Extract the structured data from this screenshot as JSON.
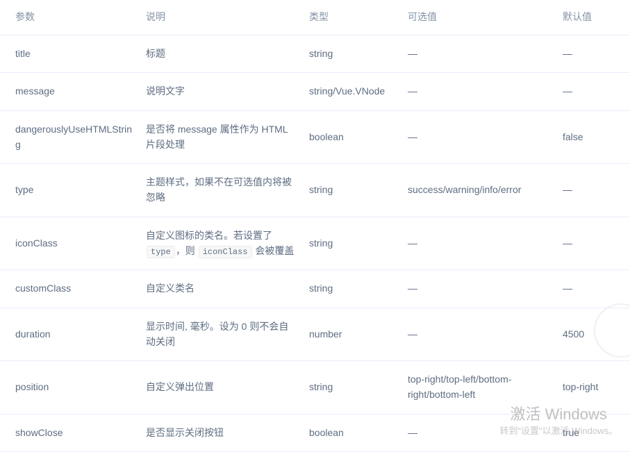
{
  "table": {
    "columns": [
      {
        "key": "param",
        "label": "参数"
      },
      {
        "key": "desc",
        "label": "说明"
      },
      {
        "key": "type",
        "label": "类型"
      },
      {
        "key": "options",
        "label": "可选值"
      },
      {
        "key": "default",
        "label": "默认值"
      }
    ],
    "rows": [
      {
        "param": "title",
        "desc": "标题",
        "type": "string",
        "options": "—",
        "default": "—"
      },
      {
        "param": "message",
        "desc": "说明文字",
        "type": "string/Vue.VNode",
        "options": "—",
        "default": "—"
      },
      {
        "param": "dangerouslyUseHTMLString",
        "desc": "是否将 message 属性作为 HTML 片段处理",
        "type": "boolean",
        "options": "—",
        "default": "false"
      },
      {
        "param": "type",
        "desc": "主题样式，如果不在可选值内将被忽略",
        "type": "string",
        "options": "success/warning/info/error",
        "default": "—"
      },
      {
        "param": "iconClass",
        "desc_parts": [
          {
            "kind": "text",
            "value": "自定义图标的类名。若设置了 "
          },
          {
            "kind": "code",
            "value": "type"
          },
          {
            "kind": "text",
            "value": "，则 "
          },
          {
            "kind": "code",
            "value": "iconClass"
          },
          {
            "kind": "text",
            "value": " 会被覆盖"
          }
        ],
        "desc": "自定义图标的类名。若设置了 type ，则 iconClass 会被覆盖",
        "type": "string",
        "options": "—",
        "default": "—"
      },
      {
        "param": "customClass",
        "desc": "自定义类名",
        "type": "string",
        "options": "—",
        "default": "—"
      },
      {
        "param": "duration",
        "desc": "显示时间, 毫秒。设为 0 则不会自动关闭",
        "type": "number",
        "options": "—",
        "default": "4500"
      },
      {
        "param": "position",
        "desc": "自定义弹出位置",
        "type": "string",
        "options": "top-right/top-left/bottom-right/bottom-left",
        "default": "top-right"
      },
      {
        "param": "showClose",
        "desc": "是否显示关闭按钮",
        "type": "boolean",
        "options": "—",
        "default": "true"
      }
    ]
  },
  "watermark": {
    "title": "激活 Windows",
    "subtitle": "转到\"设置\"以激活 Windows。"
  },
  "colors": {
    "text": "#5e6d82",
    "header_text": "#8492a6",
    "border": "#eaeefb",
    "background": "#ffffff",
    "code_bg": "#f8f8f8",
    "watermark_text": "#8d8d8d"
  }
}
